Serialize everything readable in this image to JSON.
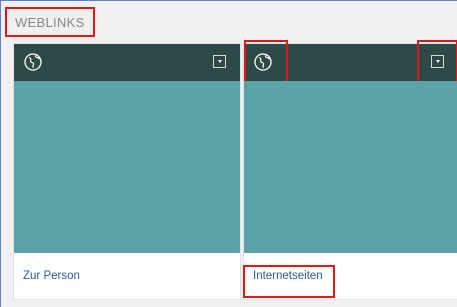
{
  "section": {
    "title": "WEBLINKS"
  },
  "cards": [
    {
      "icon": "globe-link-icon",
      "menu_icon": "chevron-down-icon",
      "label": "Zur Person"
    },
    {
      "icon": "globe-link-icon",
      "menu_icon": "chevron-down-icon",
      "label": "Internetseiten"
    }
  ],
  "colors": {
    "header": "#2e4a48",
    "body": "#5aa2a5",
    "link": "#2a5b9a",
    "highlight": "#e01818"
  }
}
